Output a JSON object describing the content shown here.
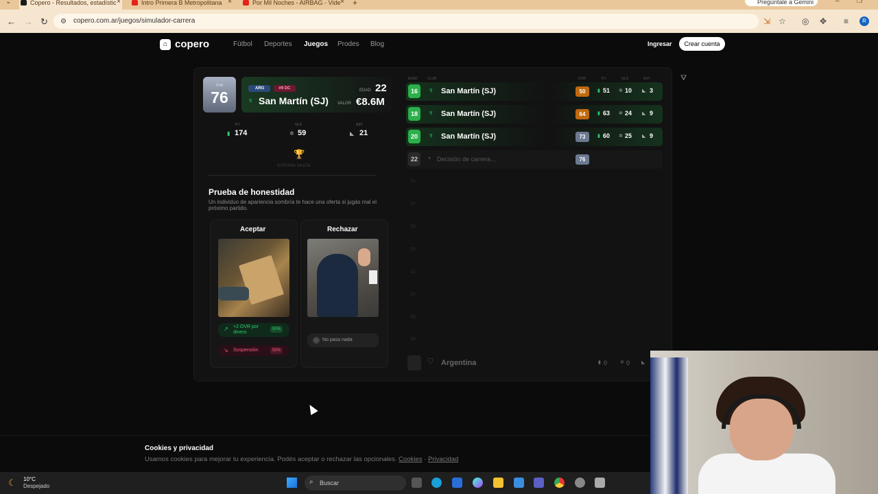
{
  "browser": {
    "tabs": [
      {
        "label": "Copero - Resultados, estadístic",
        "icon_color": "#1a1a1a"
      },
      {
        "label": "Intro Primera B Metropolitana",
        "icon_color": "#e62117"
      },
      {
        "label": "Por Mil Noches - AIRBAG - Vide",
        "icon_color": "#e62117"
      }
    ],
    "gemini_label": "Pregúntale a Gemini",
    "url": "copero.com.ar/juegos/simulador-carrera",
    "profile_initial": "R"
  },
  "site": {
    "logo": "copero",
    "nav": [
      "Fútbol",
      "Deportes",
      "Juegos",
      "Prodes",
      "Blog"
    ],
    "login": "Ingresar",
    "signup": "Crear cuenta"
  },
  "player": {
    "ovr_label": "OVR",
    "ovr": "76",
    "country": "ARG",
    "position": "#9 DC",
    "club": "San Martín (SJ)",
    "edad_label": "EDAD",
    "edad": "22",
    "valor_label": "VALOR",
    "valor": "€8.6M",
    "stats": [
      {
        "label": "PJ",
        "value": "174",
        "icon": "shirt-icon"
      },
      {
        "label": "GLS",
        "value": "59",
        "icon": "ball-icon"
      },
      {
        "label": "AST",
        "value": "21",
        "icon": "boot-icon"
      }
    ],
    "vitrina": "VITRINA VACÍA"
  },
  "event": {
    "title": "Prueba de honestidad",
    "description": "Un individuo de apariencia sombría te hace una oferta si jugás mal el próximo partido.",
    "accept": {
      "label": "Aceptar",
      "outcomes": [
        {
          "text": "+2 OVR por dinero",
          "pct": "50%"
        },
        {
          "text": "Suspensión",
          "pct": "50%"
        }
      ]
    },
    "reject": {
      "label": "Rechazar",
      "outcome": "No pasa nada"
    }
  },
  "career": {
    "headers": [
      "EDAD",
      "CLUB",
      "OVR",
      "PJ",
      "GLS",
      "AST"
    ],
    "rows": [
      {
        "age": "16",
        "club": "San Martín (SJ)",
        "ovr": "50",
        "pj": "51",
        "gls": "10",
        "ast": "3"
      },
      {
        "age": "18",
        "club": "San Martín (SJ)",
        "ovr": "64",
        "pj": "63",
        "gls": "24",
        "ast": "9"
      },
      {
        "age": "20",
        "club": "San Martín (SJ)",
        "ovr": "73",
        "pj": "60",
        "gls": "25",
        "ast": "9"
      }
    ],
    "pending": {
      "age": "22",
      "text": "Decisión de carrera...",
      "ovr": "76"
    },
    "future_ages": [
      "24",
      "26",
      "28",
      "30",
      "32",
      "34",
      "36",
      "38"
    ],
    "national": {
      "name": "Argentina",
      "pj": "0",
      "gls": "0"
    }
  },
  "cookies": {
    "title": "Cookies y privacidad",
    "text": "Usamos cookies para mejorar tu experiencia. Podés aceptar o rechazar las opcionales.",
    "link1": "Cookies",
    "sep": "·",
    "link2": "Privacidad"
  },
  "taskbar": {
    "temp": "10°C",
    "weather": "Despejado",
    "search": "Buscar"
  }
}
